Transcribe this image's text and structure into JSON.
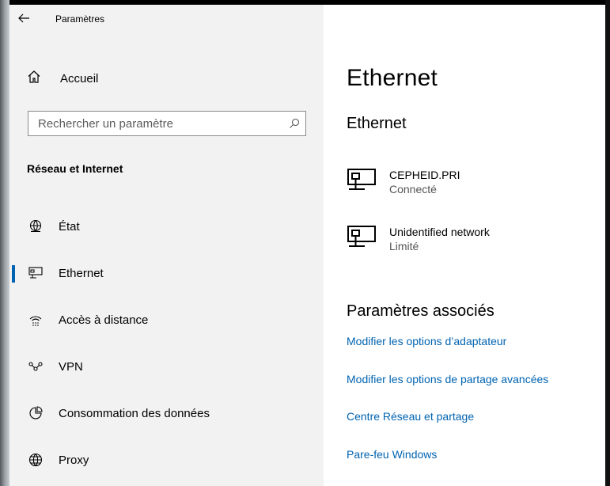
{
  "colors": {
    "accent": "#0063b1",
    "sidebar_bg": "#f2f2f2",
    "link": "#0063b1"
  },
  "header": {
    "back_icon": "back-arrow-icon",
    "title": "Paramètres"
  },
  "sidebar": {
    "home": {
      "label": "Accueil",
      "icon": "home-icon"
    },
    "search": {
      "placeholder": "Rechercher un paramètre",
      "icon": "search-icon"
    },
    "section_title": "Réseau et Internet",
    "items": [
      {
        "label": "État",
        "icon": "globe-status-icon",
        "selected": false
      },
      {
        "label": "Ethernet",
        "icon": "ethernet-icon",
        "selected": true
      },
      {
        "label": "Accès à distance",
        "icon": "dial-up-icon",
        "selected": false
      },
      {
        "label": "VPN",
        "icon": "vpn-icon",
        "selected": false
      },
      {
        "label": "Consommation des données",
        "icon": "data-usage-icon",
        "selected": false
      },
      {
        "label": "Proxy",
        "icon": "globe-icon",
        "selected": false
      }
    ]
  },
  "main": {
    "title": "Ethernet",
    "subtitle": "Ethernet",
    "networks": [
      {
        "name": "CEPHEID.PRI",
        "status": "Connecté",
        "icon": "network-computer-icon"
      },
      {
        "name": "Unidentified network",
        "status": "Limité",
        "icon": "network-computer-icon"
      }
    ],
    "related_title": "Paramètres associés",
    "related_links": [
      "Modifier les options d’adaptateur",
      "Modifier les options de partage avancées",
      "Centre Réseau et partage",
      "Pare-feu Windows"
    ]
  }
}
